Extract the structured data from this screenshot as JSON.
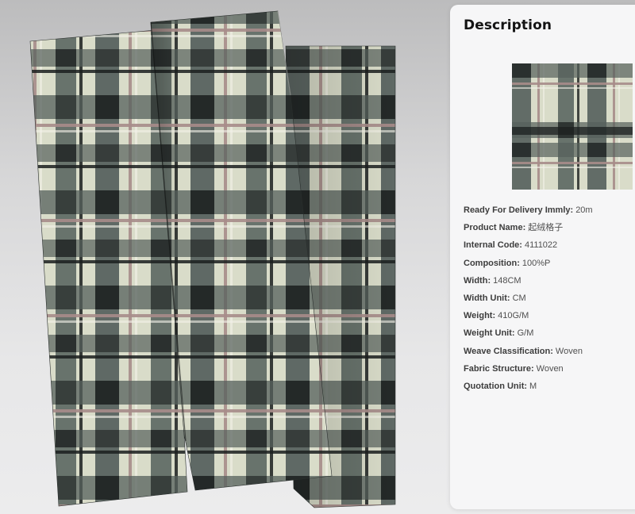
{
  "panel": {
    "title": "Description"
  },
  "photo": {
    "subject": "folded plaid fabric",
    "colors": {
      "cream": "#d9dcc9",
      "grey_green": "#55605c",
      "black": "#1b1f1e",
      "mauve": "#a88c8a",
      "white_line": "#f3f1ea"
    }
  },
  "specs": [
    {
      "label": "Ready For Delivery Immly",
      "value": "20m"
    },
    {
      "label": "Product Name",
      "value": "起绒格子"
    },
    {
      "label": "Internal Code",
      "value": "4111022"
    },
    {
      "label": "Composition",
      "value": "100%P"
    },
    {
      "label": "Width",
      "value": "148CM"
    },
    {
      "label": "Width Unit",
      "value": "CM"
    },
    {
      "label": "Weight",
      "value": "410G/M"
    },
    {
      "label": "Weight Unit",
      "value": "G/M"
    },
    {
      "label": "Weave Classification",
      "value": "Woven"
    },
    {
      "label": "Fabric Structure",
      "value": "Woven"
    },
    {
      "label": "Quotation Unit",
      "value": "M"
    }
  ]
}
